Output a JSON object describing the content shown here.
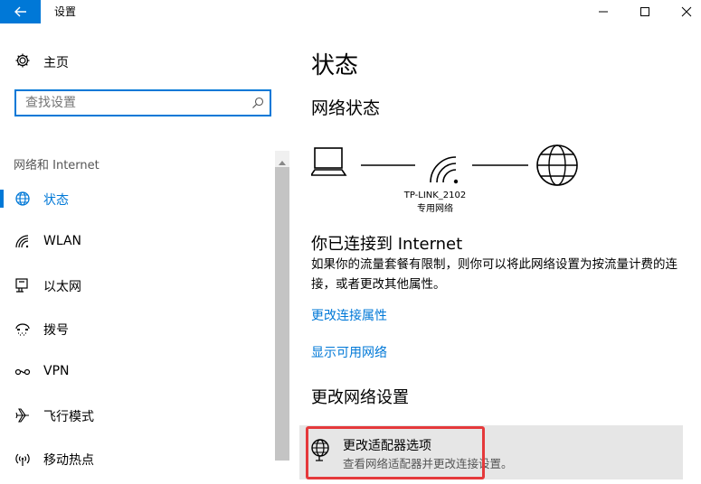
{
  "window": {
    "title": "设置",
    "accent": "#0078d7"
  },
  "nav": {
    "home_label": "主页",
    "search_placeholder": "查找设置",
    "section_label": "网络和 Internet",
    "items": [
      {
        "label": "状态",
        "icon": "globe-icon",
        "active": true
      },
      {
        "label": "WLAN",
        "icon": "wifi-icon",
        "active": false
      },
      {
        "label": "以太网",
        "icon": "ethernet-icon",
        "active": false
      },
      {
        "label": "拨号",
        "icon": "dialup-icon",
        "active": false
      },
      {
        "label": "VPN",
        "icon": "vpn-icon",
        "active": false
      },
      {
        "label": "飞行模式",
        "icon": "airplane-icon",
        "active": false
      },
      {
        "label": "移动热点",
        "icon": "hotspot-icon",
        "active": false
      }
    ]
  },
  "main": {
    "page_title": "状态",
    "network_status_title": "网络状态",
    "network_name": "TP-LINK_2102",
    "network_type": "专用网络",
    "connected_title": "你已连接到 Internet",
    "connected_desc": "如果你的流量套餐有限制，则你可以将此网络设置为按流量计费的连接，或者更改其他属性。",
    "link_change_properties": "更改连接属性",
    "link_show_networks": "显示可用网络",
    "change_settings_title": "更改网络设置",
    "adapter": {
      "title": "更改适配器选项",
      "desc": "查看网络适配器并更改连接设置。"
    }
  },
  "highlight_color": "#e5393b"
}
